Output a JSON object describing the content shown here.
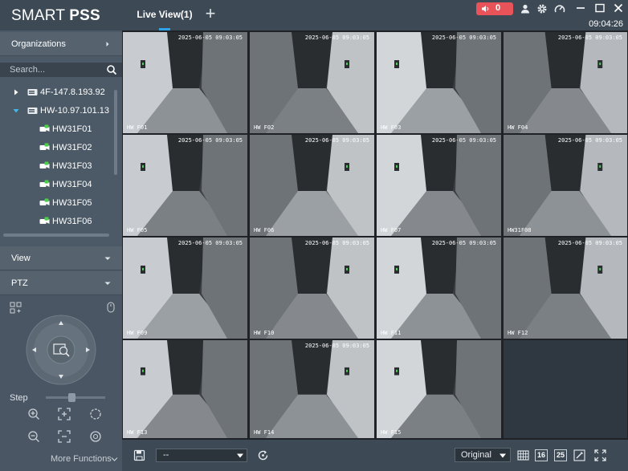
{
  "app": {
    "logo_regular": "SMART ",
    "logo_bold": "PSS",
    "clock": "09:04:26"
  },
  "tabs": [
    {
      "label": "Live View(1)"
    }
  ],
  "alarm": {
    "count": "0"
  },
  "sidebar": {
    "organizations_label": "Organizations",
    "search_placeholder": "Search...",
    "devices": [
      {
        "label": "4F-147.8.193.92",
        "expanded": false
      },
      {
        "label": "HW-10.97.101.13",
        "expanded": true
      }
    ],
    "channels": [
      {
        "label": "HW31F01"
      },
      {
        "label": "HW31F02"
      },
      {
        "label": "HW31F03"
      },
      {
        "label": "HW31F04"
      },
      {
        "label": "HW31F05"
      },
      {
        "label": "HW31F06"
      }
    ],
    "view_label": "View",
    "ptz_label": "PTZ",
    "step_label": "Step",
    "more_functions_label": "More Functions"
  },
  "grid": {
    "cells": [
      {
        "ts": "2025-06-05 09:03:05",
        "cn": "HW F01"
      },
      {
        "ts": "2025-06-05 09:03:05",
        "cn": "HW F02"
      },
      {
        "ts": "2025-06-05 09:03:05",
        "cn": "HW F03"
      },
      {
        "ts": "2025-06-05 09:03:05",
        "cn": "HW F04"
      },
      {
        "ts": "2025-06-05 09:03:05",
        "cn": "HW F05"
      },
      {
        "ts": "2025-06-05 09:03:05",
        "cn": "HW F06"
      },
      {
        "ts": "2025-06-05 09:03:05",
        "cn": "HW F07"
      },
      {
        "ts": "2025-06-05 09:03:05",
        "cn": "HW31F08"
      },
      {
        "ts": "2025-06-05 09:03:05",
        "cn": "HW F09"
      },
      {
        "ts": "2025-06-05 09:03:05",
        "cn": "HW F10"
      },
      {
        "ts": "2025-06-05 09:03:05",
        "cn": "HW F11"
      },
      {
        "ts": "2025-06-05 09:03:05",
        "cn": "HW F12"
      },
      {
        "ts": "",
        "cn": "HW F13"
      },
      {
        "ts": "2025-06-05 09:03:05",
        "cn": "HW F14"
      },
      {
        "ts": "",
        "cn": "HW F15"
      },
      {
        "ts": "",
        "cn": ""
      }
    ]
  },
  "bottombar": {
    "preset_value": "--",
    "ratio_value": "Original",
    "split_16": "16",
    "split_25": "25"
  }
}
